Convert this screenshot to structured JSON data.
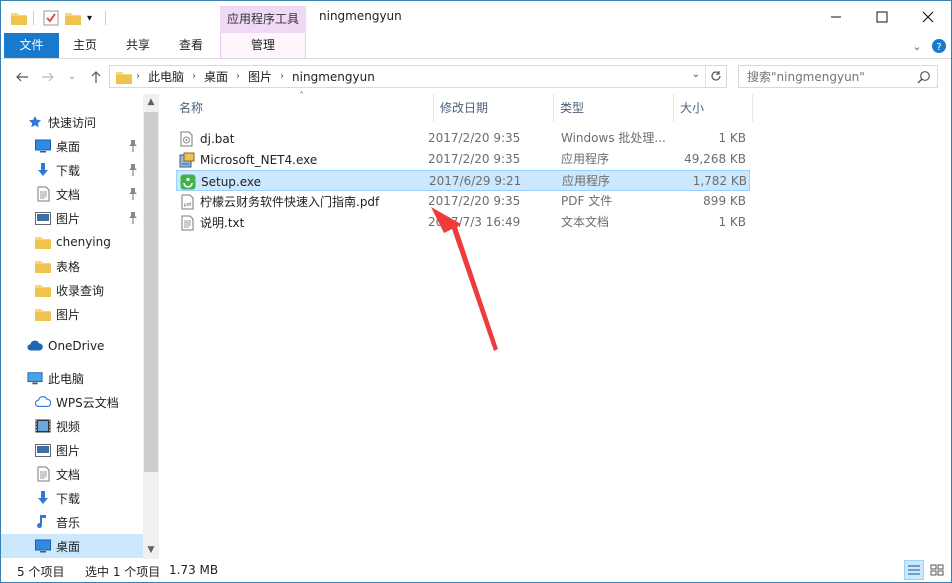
{
  "title_bar": {
    "context_tab": "应用程序工具",
    "window_title": "ningmengyun"
  },
  "ribbon": {
    "tabs": [
      {
        "label": "文件"
      },
      {
        "label": "主页"
      },
      {
        "label": "共享"
      },
      {
        "label": "查看"
      },
      {
        "label": "管理"
      }
    ]
  },
  "address_bar": {
    "breadcrumbs": [
      "此电脑",
      "桌面",
      "图片",
      "ningmengyun"
    ],
    "search_placeholder": "搜索\"ningmengyun\""
  },
  "sidebar": {
    "items": [
      {
        "label": "快速访问",
        "icon": "star-icon"
      },
      {
        "label": "桌面",
        "icon": "desktop-icon",
        "pinned": true
      },
      {
        "label": "下载",
        "icon": "download-icon",
        "pinned": true
      },
      {
        "label": "文档",
        "icon": "document-icon",
        "pinned": true
      },
      {
        "label": "图片",
        "icon": "picture-icon",
        "pinned": true
      },
      {
        "label": "chenying",
        "icon": "folder-icon"
      },
      {
        "label": "表格",
        "icon": "folder-icon"
      },
      {
        "label": "收录查询",
        "icon": "folder-icon"
      },
      {
        "label": "图片",
        "icon": "folder-icon"
      },
      {
        "label": "OneDrive",
        "icon": "cloud-icon"
      },
      {
        "label": "此电脑",
        "icon": "computer-icon"
      },
      {
        "label": "WPS云文档",
        "icon": "wps-cloud-icon"
      },
      {
        "label": "视频",
        "icon": "video-icon"
      },
      {
        "label": "图片",
        "icon": "picture-icon"
      },
      {
        "label": "文档",
        "icon": "document-icon"
      },
      {
        "label": "下载",
        "icon": "download-icon"
      },
      {
        "label": "音乐",
        "icon": "music-icon"
      },
      {
        "label": "桌面",
        "icon": "desktop-icon",
        "selected": true
      }
    ]
  },
  "file_list": {
    "columns": [
      "名称",
      "修改日期",
      "类型",
      "大小"
    ],
    "rows": [
      {
        "name": "dj.bat",
        "date": "2017/2/20 9:35",
        "type": "Windows 批处理...",
        "size": "1 KB",
        "icon": "batch-file-icon"
      },
      {
        "name": "Microsoft_NET4.exe",
        "date": "2017/2/20 9:35",
        "type": "应用程序",
        "size": "49,268 KB",
        "icon": "installer-icon"
      },
      {
        "name": "Setup.exe",
        "date": "2017/6/29 9:21",
        "type": "应用程序",
        "size": "1,782 KB",
        "icon": "setup-app-icon",
        "selected": true
      },
      {
        "name": "柠檬云财务软件快速入门指南.pdf",
        "date": "2017/2/20 9:35",
        "type": "PDF 文件",
        "size": "899 KB",
        "icon": "pdf-file-icon"
      },
      {
        "name": "说明.txt",
        "date": "2017/7/3 16:49",
        "type": "文本文档",
        "size": "1 KB",
        "icon": "text-file-icon"
      }
    ]
  },
  "status_bar": {
    "item_count": "5 个项目",
    "selected": "选中 1 个项目",
    "selected_size": "1.73 MB"
  },
  "colors": {
    "accent": "#1979ca",
    "selection": "#cce8ff",
    "annotation_arrow": "#ef3b3b"
  }
}
